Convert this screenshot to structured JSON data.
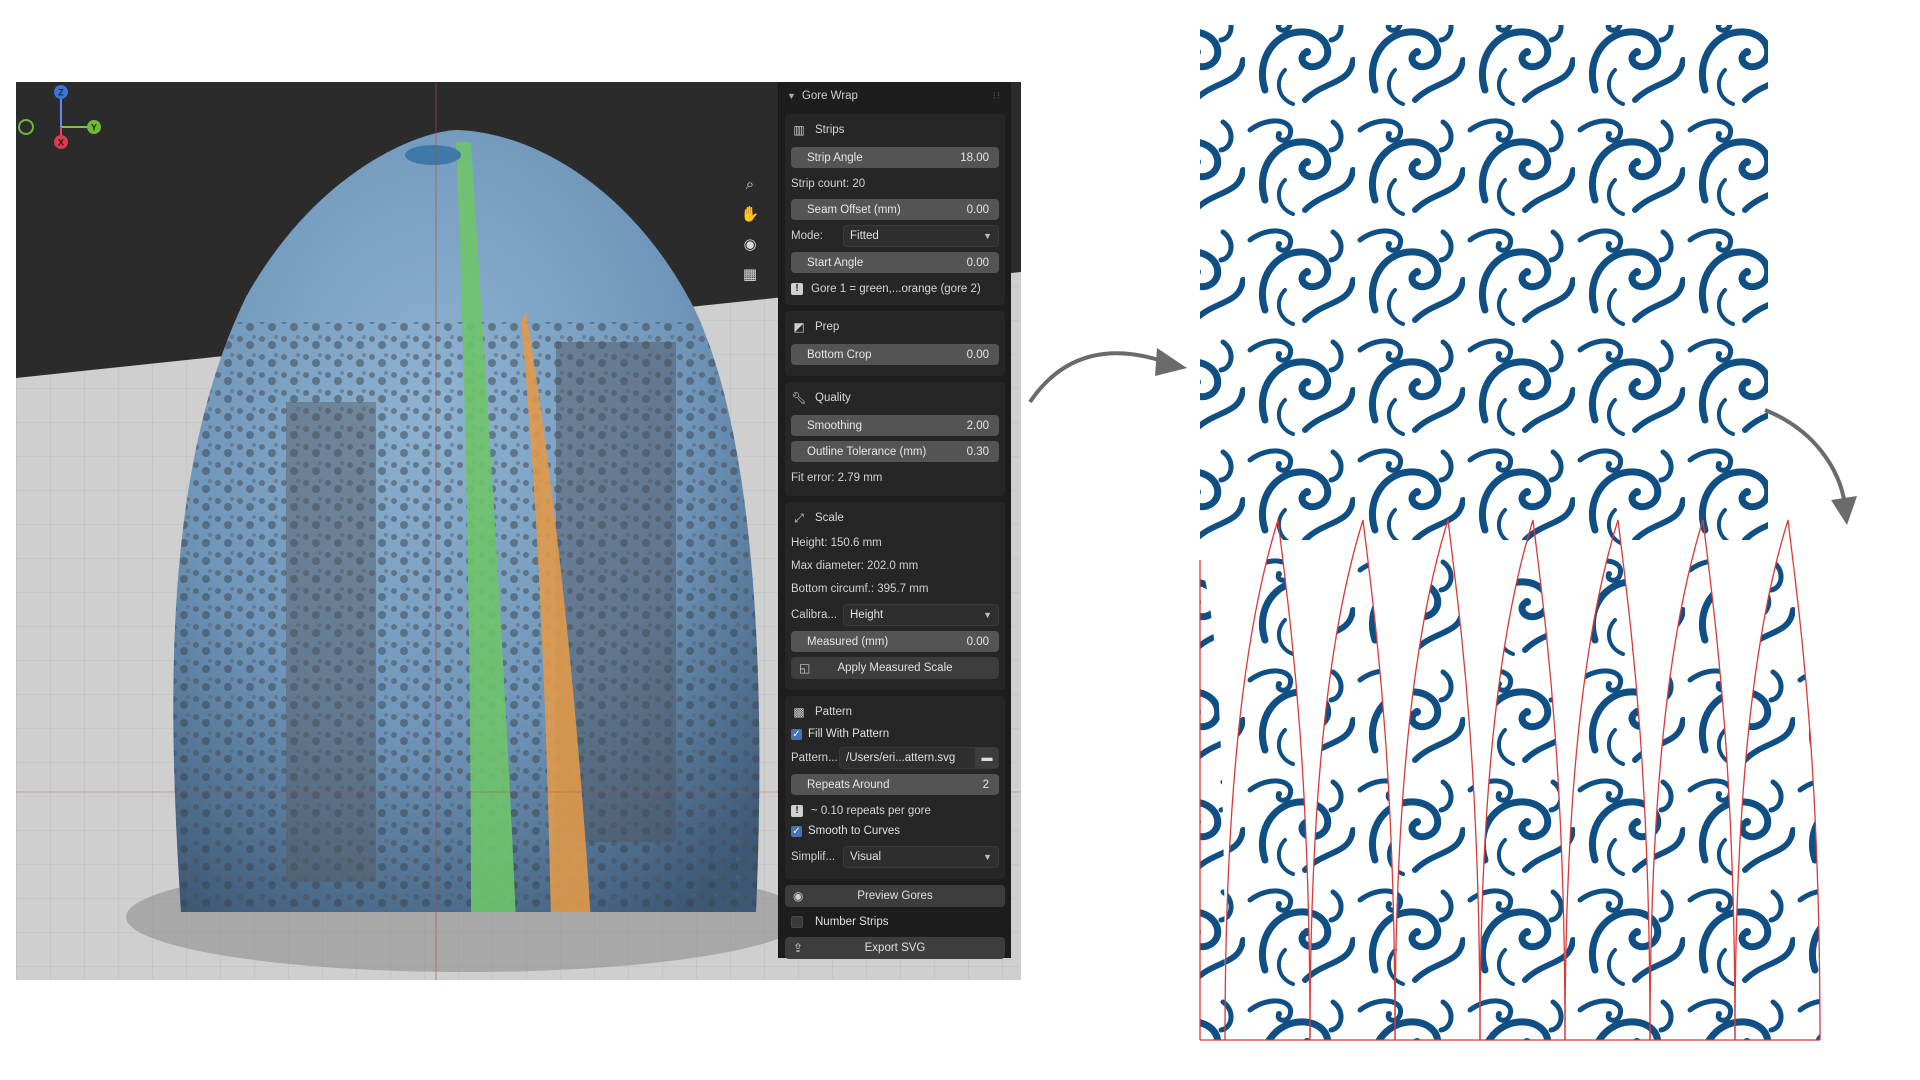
{
  "panel": {
    "title": "Gore Wrap",
    "strips": {
      "title": "Strips",
      "strip_angle": {
        "label": "Strip Angle",
        "value": "18.00"
      },
      "strip_count": "Strip count: 20",
      "seam_offset": {
        "label": "Seam Offset (mm)",
        "value": "0.00"
      },
      "mode": {
        "label": "Mode:",
        "value": "Fitted"
      },
      "start_angle": {
        "label": "Start Angle",
        "value": "0.00"
      },
      "gore_info": "Gore 1 = green,...orange (gore 2)"
    },
    "prep": {
      "title": "Prep",
      "bottom_crop": {
        "label": "Bottom Crop",
        "value": "0.00"
      }
    },
    "quality": {
      "title": "Quality",
      "smoothing": {
        "label": "Smoothing",
        "value": "2.00"
      },
      "outline_tolerance": {
        "label": "Outline Tolerance (mm)",
        "value": "0.30"
      },
      "fit_error": "Fit error: 2.79 mm"
    },
    "scale": {
      "title": "Scale",
      "height": "Height: 150.6 mm",
      "max_diameter": "Max diameter: 202.0 mm",
      "bottom_circumf": "Bottom circumf.: 395.7 mm",
      "calibrate": {
        "label": "Calibra...",
        "value": "Height"
      },
      "measured": {
        "label": "Measured (mm)",
        "value": "0.00"
      },
      "apply_button": "Apply Measured Scale"
    },
    "pattern": {
      "title": "Pattern",
      "fill_with_pattern": "Fill With Pattern",
      "pattern_path": {
        "label": "Pattern...",
        "value": "/Users/eri...attern.svg"
      },
      "repeats_around": {
        "label": "Repeats Around",
        "value": "2"
      },
      "repeats_info": "~ 0.10 repeats per gore",
      "smooth_to_curves": "Smooth to Curves",
      "simplify": {
        "label": "Simplif...",
        "value": "Visual"
      }
    },
    "preview_gores": "Preview Gores",
    "number_strips": "Number Strips",
    "export_svg": "Export SVG"
  },
  "gizmo": {
    "z": "Z",
    "y": "Y",
    "x": "X"
  },
  "colors": {
    "panel_bg": "#1d1d1d",
    "field_bg": "#545454",
    "accent_blue": "#4772b3",
    "gore_green": "#6fc46a",
    "gore_orange": "#e09a4a",
    "pattern_blue": "#0f4f84",
    "gore_outline": "#d83a3a"
  }
}
